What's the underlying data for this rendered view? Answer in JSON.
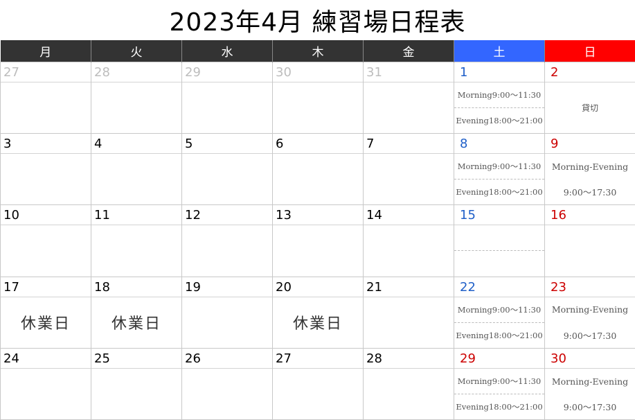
{
  "title": "2023年4月 練習場日程表",
  "weekdays": [
    "月",
    "火",
    "水",
    "木",
    "金",
    "土",
    "日"
  ],
  "weekday_colors": {
    "sat": "#3366ff",
    "sun": "#ff0000",
    "weekday": "#333333"
  },
  "weeks": [
    {
      "days": [
        {
          "num": "27",
          "style": "gray"
        },
        {
          "num": "28",
          "style": "gray"
        },
        {
          "num": "29",
          "style": "gray"
        },
        {
          "num": "30",
          "style": "gray"
        },
        {
          "num": "31",
          "style": "gray"
        },
        {
          "num": "1",
          "style": "blue",
          "slots": [
            "Morning9:00～11:30",
            "Evening18:00～21:00"
          ]
        },
        {
          "num": "2",
          "style": "red",
          "note": "貸切"
        }
      ]
    },
    {
      "days": [
        {
          "num": "3"
        },
        {
          "num": "4"
        },
        {
          "num": "5"
        },
        {
          "num": "6"
        },
        {
          "num": "7"
        },
        {
          "num": "8",
          "style": "blue",
          "slots": [
            "Morning9:00～11:30",
            "Evening18:00～21:00"
          ]
        },
        {
          "num": "9",
          "style": "red",
          "sunslots": [
            "Morning-Evening",
            "9:00～17:30"
          ]
        }
      ]
    },
    {
      "days": [
        {
          "num": "10"
        },
        {
          "num": "11"
        },
        {
          "num": "12"
        },
        {
          "num": "13"
        },
        {
          "num": "14"
        },
        {
          "num": "15",
          "style": "blue",
          "slots": [
            "",
            ""
          ]
        },
        {
          "num": "16",
          "style": "red"
        }
      ]
    },
    {
      "days": [
        {
          "num": "17",
          "holiday": "休業日"
        },
        {
          "num": "18",
          "holiday": "休業日"
        },
        {
          "num": "19"
        },
        {
          "num": "20",
          "holiday": "休業日"
        },
        {
          "num": "21"
        },
        {
          "num": "22",
          "style": "blue",
          "slots": [
            "Morning9:00～11:30",
            "Evening18:00～21:00"
          ]
        },
        {
          "num": "23",
          "style": "red",
          "sunslots": [
            "Morning-Evening",
            "9:00～17:30"
          ]
        }
      ]
    },
    {
      "days": [
        {
          "num": "24"
        },
        {
          "num": "25"
        },
        {
          "num": "26"
        },
        {
          "num": "27"
        },
        {
          "num": "28"
        },
        {
          "num": "29",
          "style": "red",
          "slots": [
            "Morning9:00～11:30",
            "Evening18:00～21:00"
          ]
        },
        {
          "num": "30",
          "style": "red",
          "sunslots": [
            "Morning-Evening",
            "9:00～17:30"
          ]
        }
      ]
    }
  ]
}
